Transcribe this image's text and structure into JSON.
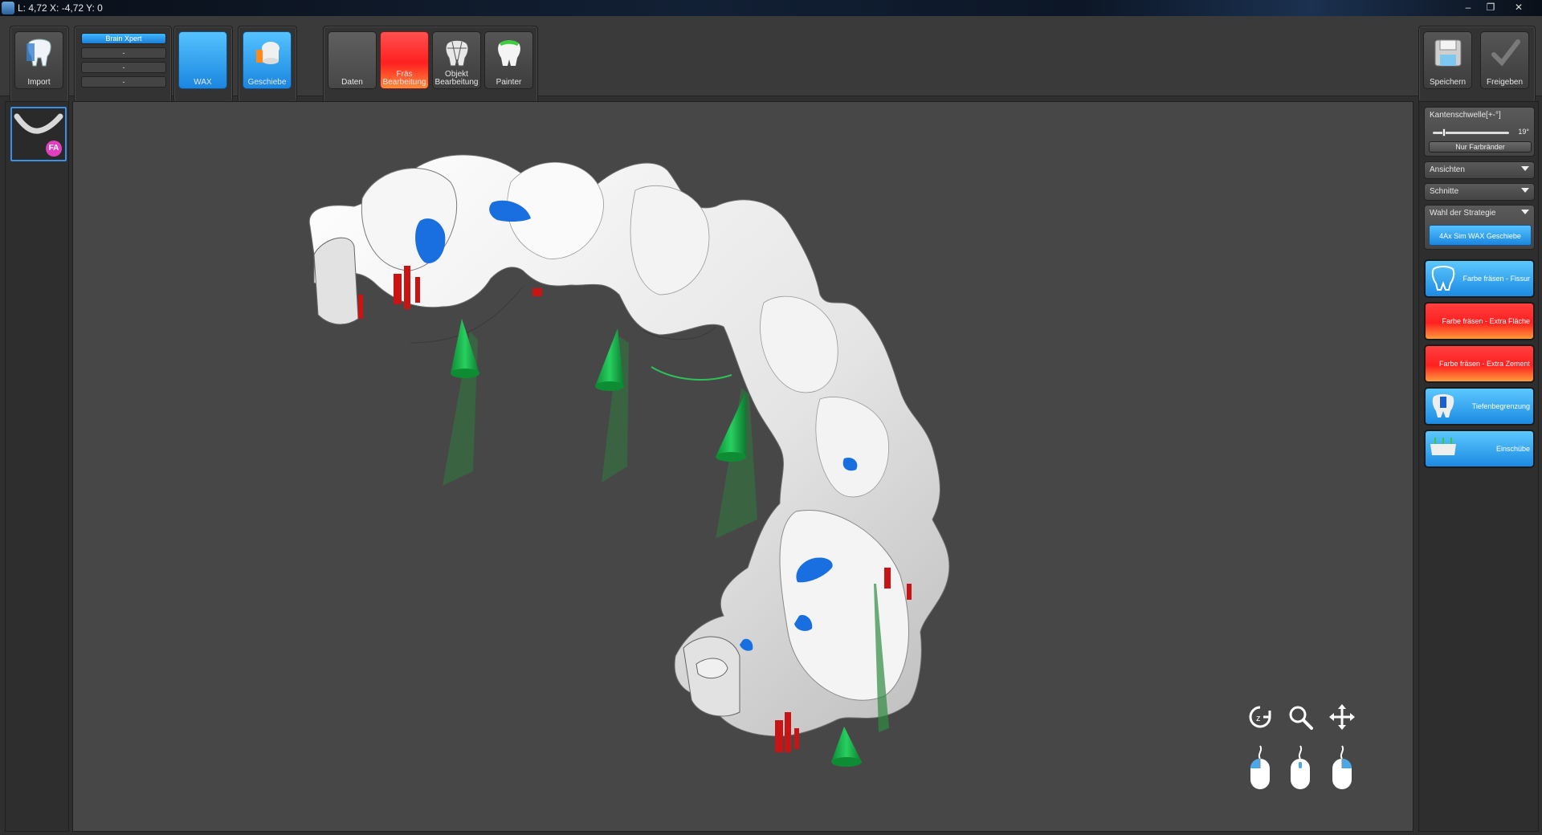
{
  "titlebar": {
    "text": "L: 4,72 X: -4,72 Y: 0"
  },
  "toolbar": {
    "import_label": "Import",
    "brainxpert": {
      "title": "Brain Xpert",
      "slots": [
        "-",
        "-",
        "-"
      ]
    },
    "wax_label": "WAX",
    "geschiebe_label": "Geschiebe",
    "daten_label": "Daten",
    "fraes_label": "Fräs\nBearbeitung",
    "objekt_label": "Objekt\nBearbeitung",
    "painter_label": "Painter",
    "speichern_label": "Speichern",
    "freigeben_label": "Freigeben"
  },
  "left_panel": {
    "badge": "FA"
  },
  "right_panel": {
    "kanten": {
      "title": "Kantenschwelle[+-°]",
      "value": "19°",
      "button": "Nur Farbränder"
    },
    "ansichten": "Ansichten",
    "schnitte": "Schnitte",
    "strategie": {
      "title": "Wahl der Strategie",
      "button": "4Ax Sim WAX Geschiebe"
    },
    "buttons": [
      {
        "label": "Farbe fräsen - Fissur",
        "color": "blue"
      },
      {
        "label": "Farbe fräsen - Extra Fläche",
        "color": "red"
      },
      {
        "label": "Farbe fräsen - Extra Zement",
        "color": "red"
      },
      {
        "label": "Tiefenbegrenzung",
        "color": "blue"
      },
      {
        "label": "Einschübe",
        "color": "blue"
      }
    ]
  },
  "viewport": {
    "nav_icons": [
      "rotate-icon",
      "zoom-icon",
      "pan-icon"
    ],
    "mouse_icons": [
      "mouse-left-icon",
      "mouse-middle-icon",
      "mouse-right-icon"
    ]
  },
  "colors": {
    "accent_blue": "#1a86e0",
    "accent_red": "#ff2020",
    "model_white": "#e8e8e8",
    "paint_blue": "#1a6fe0",
    "paint_red": "#c81414",
    "cone_green": "#19b04a"
  }
}
